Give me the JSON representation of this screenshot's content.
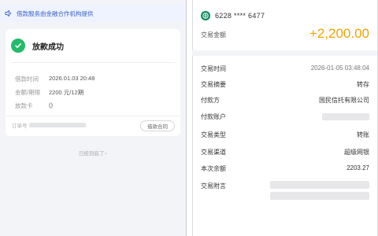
{
  "left": {
    "notice_text": "借款服务由金融合作机构提供",
    "status_title": "放款成功",
    "info": [
      {
        "label": "借款时间",
        "value": "2026.01.03 20:48"
      },
      {
        "label": "金额/期限",
        "value": "2200 元/12期"
      },
      {
        "label": "放款卡",
        "value": "()"
      }
    ],
    "order_label": "订单号",
    "contract_button": "借款合同",
    "bottom_tip": "已经到底了~"
  },
  "right": {
    "card_number": "6228 **** 6477",
    "amount_label": "交易金额",
    "amount_value": "+2,200.00",
    "rows": [
      {
        "label": "交易时间",
        "value": "2026-01-05 03:48:04"
      },
      {
        "label": "交易摘要",
        "value": "转存"
      },
      {
        "label": "付款方",
        "value": "国民信托有限公司"
      },
      {
        "label": "付款账户",
        "value": ""
      },
      {
        "label": "交易类型",
        "value": "转账"
      },
      {
        "label": "交易渠道",
        "value": "超级网银"
      },
      {
        "label": "本次余额",
        "value": "2203.27"
      },
      {
        "label": "交易附言",
        "value": ""
      }
    ]
  },
  "colors": {
    "accent_blue": "#3a62c8",
    "success_green": "#22bb6a",
    "amount_orange": "#f2a300",
    "bank_green": "#0e8a5a"
  },
  "icons": [
    "speaker-icon",
    "check-icon",
    "bank-logo-icon"
  ]
}
